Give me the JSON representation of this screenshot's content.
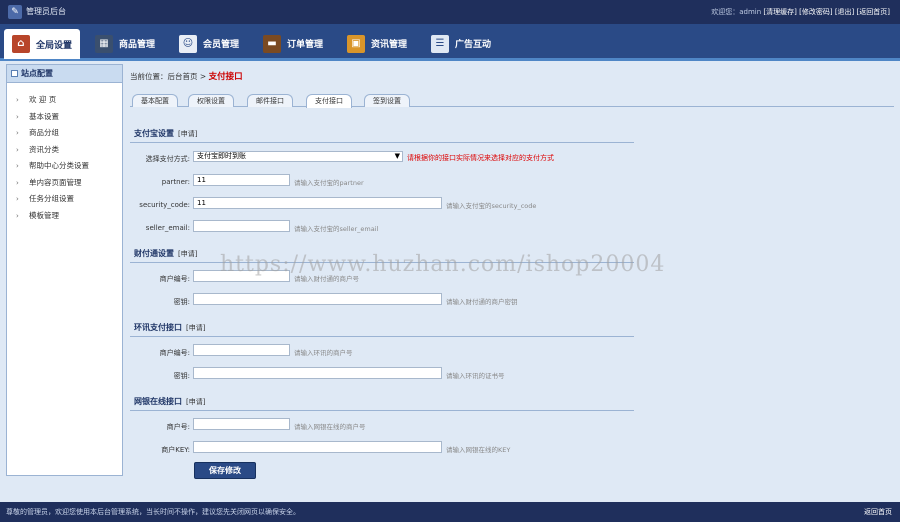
{
  "topbar": {
    "title": "管理员后台",
    "welcome": "欢迎您：admin",
    "links": [
      "[清理缓存]",
      "[修改密码]",
      "[退出]",
      "[返回首页]"
    ]
  },
  "nav": [
    {
      "label": "全局设置",
      "icon": "house-icon",
      "active": true
    },
    {
      "label": "商品管理",
      "icon": "grid-icon"
    },
    {
      "label": "会员管理",
      "icon": "member-card-icon"
    },
    {
      "label": "订单管理",
      "icon": "wallet-icon"
    },
    {
      "label": "资讯管理",
      "icon": "box-icon"
    },
    {
      "label": "广告互动",
      "icon": "list-icon"
    }
  ],
  "sidebar": {
    "header": "站点配置",
    "items": [
      "欢 迎 页",
      "基本设置",
      "商品分组",
      "资讯分类",
      "帮助中心分类设置",
      "单内容页面管理",
      "任务分组设置",
      "模板管理"
    ]
  },
  "breadcrumb": {
    "prefix": "当前位置：后台首页 >",
    "current": "支付接口"
  },
  "tabs": [
    "基本配置",
    "权限设置",
    "邮件接口",
    "支付接口",
    "签到设置"
  ],
  "alipay": {
    "title": "支付宝设置",
    "apply": "[申请]",
    "method_label": "选择支付方式:",
    "method_value": "支付宝即时到账",
    "method_hint": "请根据你的接口实际情况来选择对应的支付方式",
    "partner_label": "partner:",
    "partner_value": "11",
    "partner_hint": "请输入支付宝的partner",
    "code_label": "security_code:",
    "code_value": "11",
    "code_hint": "请输入支付宝的security_code",
    "email_label": "seller_email:",
    "email_value": "",
    "email_hint": "请输入支付宝的seller_email"
  },
  "tenpay": {
    "title": "财付通设置",
    "apply": "[申请]",
    "merchant_label": "商户编号:",
    "merchant_hint": "请输入财付通的商户号",
    "key_label": "密钥:",
    "key_hint": "请输入财付通的商户密钥"
  },
  "ips": {
    "title": "环讯支付接口",
    "apply": "[申请]",
    "merchant_label": "商户编号:",
    "merchant_hint": "请输入环讯的商户号",
    "key_label": "密钥:",
    "key_hint": "请输入环讯的证书号"
  },
  "chinabank": {
    "title": "网银在线接口",
    "apply": "[申请]",
    "merchant_label": "商户号:",
    "merchant_hint": "请输入网银在线的商户号",
    "key_label": "商户KEY:",
    "key_hint": "请输入网银在线的KEY"
  },
  "save_label": "保存修改",
  "watermark": "https://www.huzhan.com/ishop20004",
  "footer": {
    "left": "尊敬的管理员，欢迎您使用本后台管理系统，当长时间不操作，建议您先关闭网页以确保安全。",
    "right": "返回首页"
  },
  "colors": {
    "header": "#1f2f5c",
    "nav": "#2a4a86",
    "accent": "#c00000",
    "page": "#dfe9f5"
  }
}
